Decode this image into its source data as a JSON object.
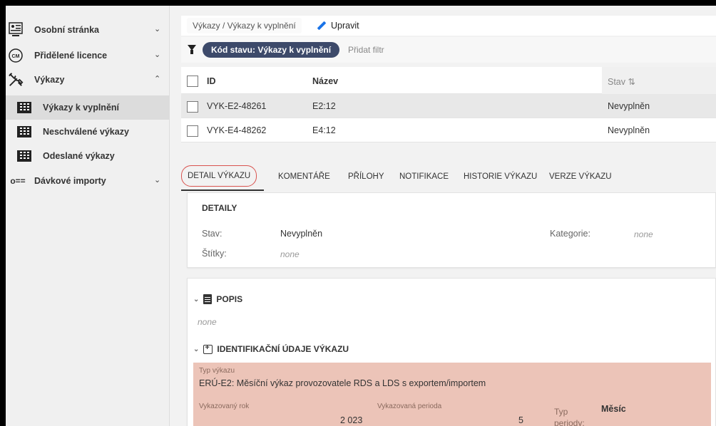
{
  "sidebar": {
    "items": [
      {
        "label": "Osobní stránka",
        "icon": "profile-icon",
        "chevron": "⌄"
      },
      {
        "label": "Přidělené licence",
        "icon": "license-badge-icon",
        "chevron": "⌄"
      },
      {
        "label": "Výkazy",
        "icon": "tools-icon",
        "chevron": "⌃"
      },
      {
        "label": "Dávkové importy",
        "icon": "batch-import-icon",
        "chevron": "⌄"
      }
    ],
    "subitems": [
      {
        "label": "Výkazy k vyplnění",
        "icon": "table-icon",
        "active": true
      },
      {
        "label": "Neschválené výkazy",
        "icon": "table-icon",
        "active": false
      },
      {
        "label": "Odeslané výkazy",
        "icon": "table-icon",
        "active": false
      }
    ],
    "license_icon_text": "CM",
    "import_icon_text": "o=="
  },
  "header": {
    "breadcrumb": "Výkazy / Výkazy k vyplnění",
    "edit_label": "Upravit"
  },
  "filter": {
    "chip_label": "Kód stavu: Výkazy k vyplnění",
    "add_label": "Přidat filtr"
  },
  "table": {
    "columns": {
      "id": "ID",
      "name": "Název",
      "status": "Stav ⇅"
    },
    "rows": [
      {
        "id": "VYK-E2-48261",
        "name": "E2:12",
        "status": "Nevyplněn"
      },
      {
        "id": "VYK-E4-48262",
        "name": "E4:12",
        "status": "Nevyplněn"
      }
    ]
  },
  "tabs": [
    "DETAIL VÝKAZU",
    "KOMENTÁŘE",
    "PŘÍLOHY",
    "NOTIFIKACE",
    "HISTORIE VÝKAZU",
    "VERZE VÝKAZU"
  ],
  "details": {
    "title": "DETAILY",
    "stav_label": "Stav:",
    "stav_value": "Nevyplněn",
    "stitky_label": "Štítky:",
    "stitky_value": "none",
    "kategorie_label": "Kategorie:",
    "kategorie_value": "none"
  },
  "popis": {
    "title": "POPIS",
    "value": "none"
  },
  "identifikace": {
    "title": "IDENTIFIKAČNÍ ÚDAJE VÝKAZU",
    "typ_label": "Typ výkazu",
    "typ_value": "ERÚ-E2: Měsíční výkaz provozovatele RDS a LDS s exportem/importem",
    "rok_label": "Vykazovaný rok",
    "rok_value": "2 023",
    "perioda_label": "Vykazovaná perioda",
    "perioda_value": "5",
    "typ_periody_label_1": "Typ",
    "typ_periody_label_2": "periody:",
    "typ_periody_value": "Měsíc"
  },
  "colors": {
    "chip_bg": "#3d4a6a",
    "active_tab_outline": "#d9534f",
    "salmon": "#ecc4b8",
    "edit_icon": "#1a73e8"
  }
}
